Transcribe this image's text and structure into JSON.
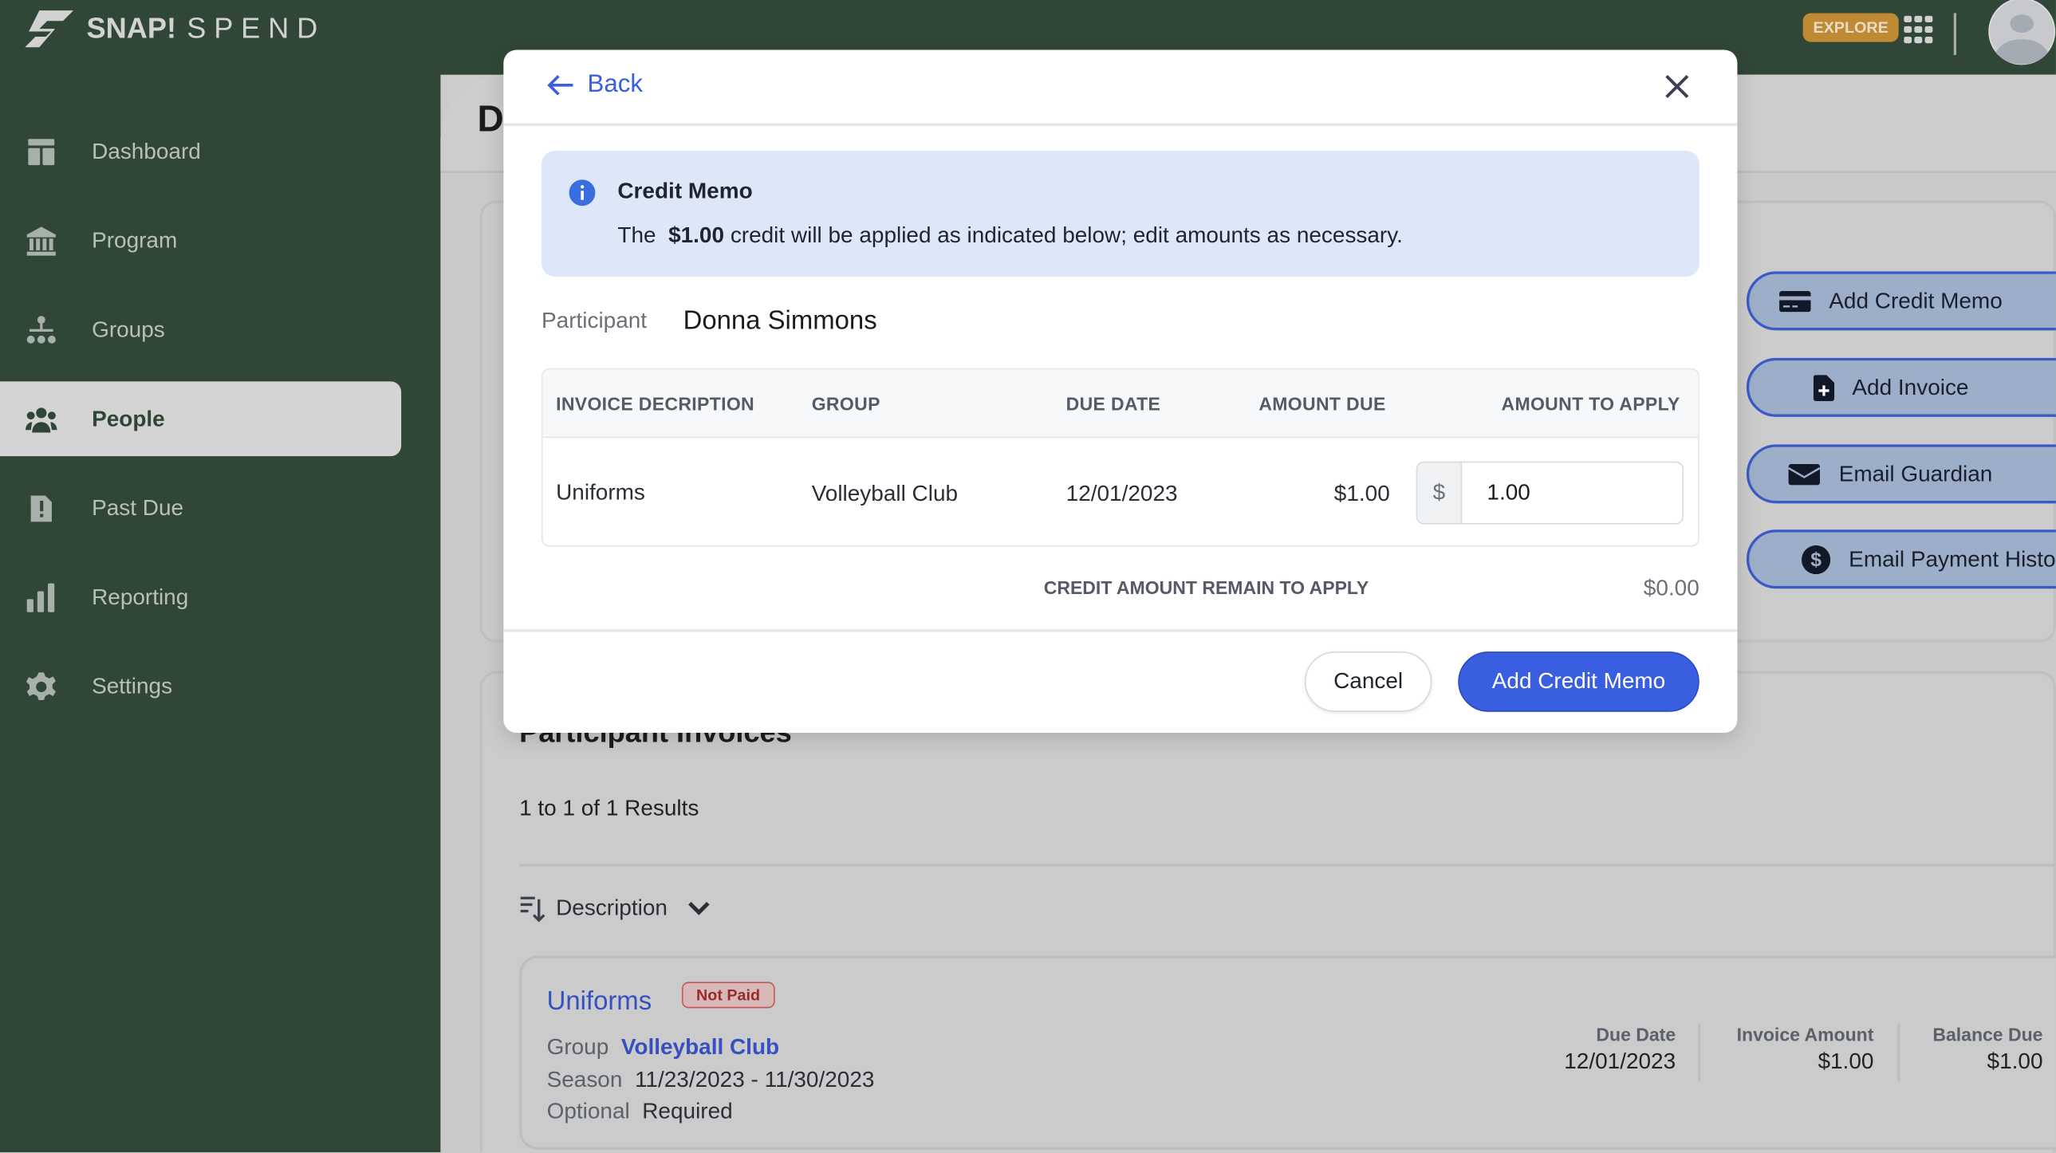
{
  "app": {
    "brand_bold": "SNAP!",
    "brand_light": "SPEND",
    "explore": "EXPLORE"
  },
  "sidebar": {
    "items": [
      {
        "label": "Dashboard",
        "icon": "dashboard-icon"
      },
      {
        "label": "Program",
        "icon": "bank-icon"
      },
      {
        "label": "Groups",
        "icon": "hierarchy-icon"
      },
      {
        "label": "People",
        "icon": "people-icon",
        "active": true
      },
      {
        "label": "Past Due",
        "icon": "alert-file-icon"
      },
      {
        "label": "Reporting",
        "icon": "bar-chart-icon"
      },
      {
        "label": "Settings",
        "icon": "gear-icon"
      }
    ]
  },
  "page": {
    "title_partial": "D",
    "section_title": "Participant Invoices",
    "results": "1 to 1 of 1 Results",
    "sort_label": "Description"
  },
  "actions": [
    "Add Credit Memo",
    "Add Invoice",
    "Email Guardian",
    "Email Payment History"
  ],
  "invoice_card": {
    "title": "Uniforms",
    "badge": "Not Paid",
    "group_label": "Group",
    "group": "Volleyball Club",
    "season_label": "Season",
    "season": "11/23/2023 - 11/30/2023",
    "optional_label": "Optional",
    "optional": "Required",
    "cols": [
      {
        "label": "Due Date",
        "value": "12/01/2023"
      },
      {
        "label": "Invoice Amount",
        "value": "$1.00"
      },
      {
        "label": "Balance Due",
        "value": "$1.00"
      }
    ]
  },
  "modal": {
    "back": "Back",
    "info_title": "Credit Memo",
    "info_pre": "The",
    "info_amount": "$1.00",
    "info_post": "credit will be applied as indicated below; edit amounts as necessary.",
    "participant_label": "Participant",
    "participant": "Donna Simmons",
    "headers": [
      "INVOICE DECRIPTION",
      "GROUP",
      "DUE DATE",
      "AMOUNT DUE",
      "AMOUNT TO APPLY"
    ],
    "row": {
      "description": "Uniforms",
      "group": "Volleyball Club",
      "due": "12/01/2023",
      "amount_due": "$1.00",
      "currency": "$",
      "apply": "1.00"
    },
    "remain_label": "CREDIT AMOUNT REMAIN TO APPLY",
    "remain_value": "$0.00",
    "cancel": "Cancel",
    "submit": "Add Credit Memo"
  },
  "colors": {
    "sidebar": "#304737",
    "accent": "#3a5ee0",
    "explore": "#c08a34",
    "info_bg": "#dde7f7"
  }
}
